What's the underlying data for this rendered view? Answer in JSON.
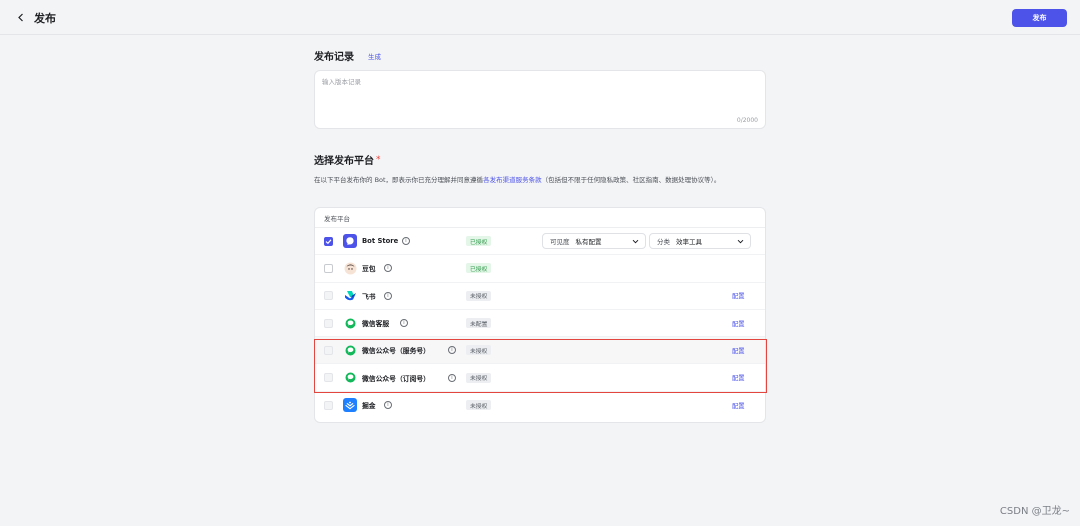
{
  "header": {
    "title": "发布",
    "publish_label": "发布"
  },
  "record": {
    "title": "发布记录",
    "generate_label": "生成",
    "placeholder": "输入版本记录",
    "counter": "0/2000"
  },
  "platform": {
    "title": "选择发布平台",
    "required_mark": "*",
    "desc_before": "在以下平台发布你的 Bot，即表示你已充分理解并同意遵循",
    "desc_link": "各发布渠道服务条款",
    "desc_after": "（包括但不限于任何隐私政策、社区指南、数据处理协议等）。",
    "table_header": "发布平台",
    "rows": [
      {
        "name": "Bot Store",
        "status": "已授权",
        "icon": "bot-store-icon",
        "checked": true
      },
      {
        "name": "豆包",
        "status": "已授权",
        "icon": "doubao-icon",
        "checked": false
      },
      {
        "name": "飞书",
        "status": "未授权",
        "icon": "feishu-icon",
        "config": "配置"
      },
      {
        "name": "微信客服",
        "status": "未配置",
        "icon": "wechat-icon",
        "config": "配置"
      },
      {
        "name": "微信公众号（服务号）",
        "status": "未授权",
        "icon": "wechat-icon",
        "config": "配置"
      },
      {
        "name": "微信公众号（订阅号）",
        "status": "未授权",
        "icon": "wechat-icon",
        "config": "配置"
      },
      {
        "name": "掘金",
        "status": "未授权",
        "icon": "juejin-icon",
        "config": "配置"
      }
    ],
    "visibility": {
      "label": "可见度",
      "value": "私有配置"
    },
    "category": {
      "label": "分类",
      "value": "效率工具"
    }
  },
  "colors": {
    "accent": "#4d53e8",
    "highlight_border": "#e3453f",
    "authorized_bg": "#e4f6e8",
    "authorized_text": "#2e9a4a"
  },
  "watermark": "CSDN @卫龙~"
}
